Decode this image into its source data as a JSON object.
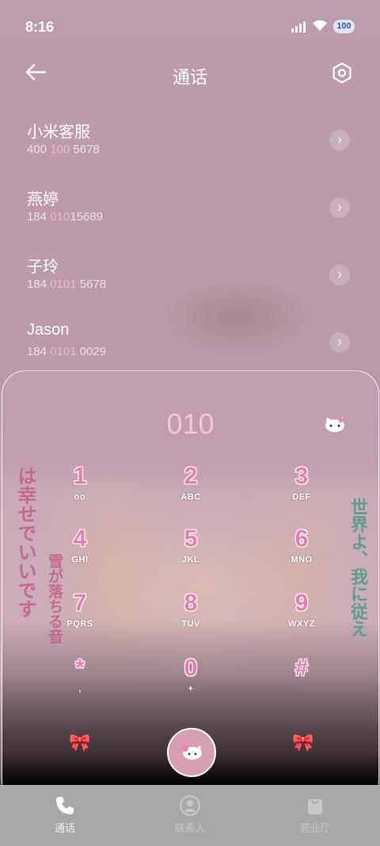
{
  "status_bar": {
    "time": "8:16",
    "battery": "100"
  },
  "header": {
    "title": "通话"
  },
  "call_log": [
    {
      "name": "小米客服",
      "num_pre": "400 ",
      "num_hl": "100",
      "num_post": " 5678"
    },
    {
      "name": "燕婷",
      "num_pre": "184 ",
      "num_hl": "010",
      "num_post": "15689"
    },
    {
      "name": "子玲",
      "num_pre": "184 ",
      "num_hl": "0101",
      "num_post": " 5678"
    },
    {
      "name": "Jason",
      "num_pre": "184 ",
      "num_hl": "0101",
      "num_post": " 0029"
    }
  ],
  "dialer": {
    "entered": "010",
    "keys": [
      {
        "digit": "1",
        "letters": "ᴏᴏ"
      },
      {
        "digit": "2",
        "letters": "ABC"
      },
      {
        "digit": "3",
        "letters": "DEF"
      },
      {
        "digit": "4",
        "letters": "GHI"
      },
      {
        "digit": "5",
        "letters": "JKL"
      },
      {
        "digit": "6",
        "letters": "MNO"
      },
      {
        "digit": "7",
        "letters": "PQRS"
      },
      {
        "digit": "8",
        "letters": "TUV"
      },
      {
        "digit": "9",
        "letters": "WXYZ"
      },
      {
        "digit": "*",
        "letters": ","
      },
      {
        "digit": "0",
        "letters": "+"
      },
      {
        "digit": "#",
        "letters": ""
      }
    ],
    "wallpaper_text_left": "は幸せでいいです",
    "wallpaper_text_left2": "雪が落ちる音",
    "wallpaper_text_right": "世界よ、我に従え"
  },
  "bottom_nav": [
    {
      "label": "通话",
      "icon": "phone-icon",
      "active": true
    },
    {
      "label": "联系人",
      "icon": "contact-icon",
      "active": false
    },
    {
      "label": "营业厅",
      "icon": "store-icon",
      "active": false
    }
  ]
}
